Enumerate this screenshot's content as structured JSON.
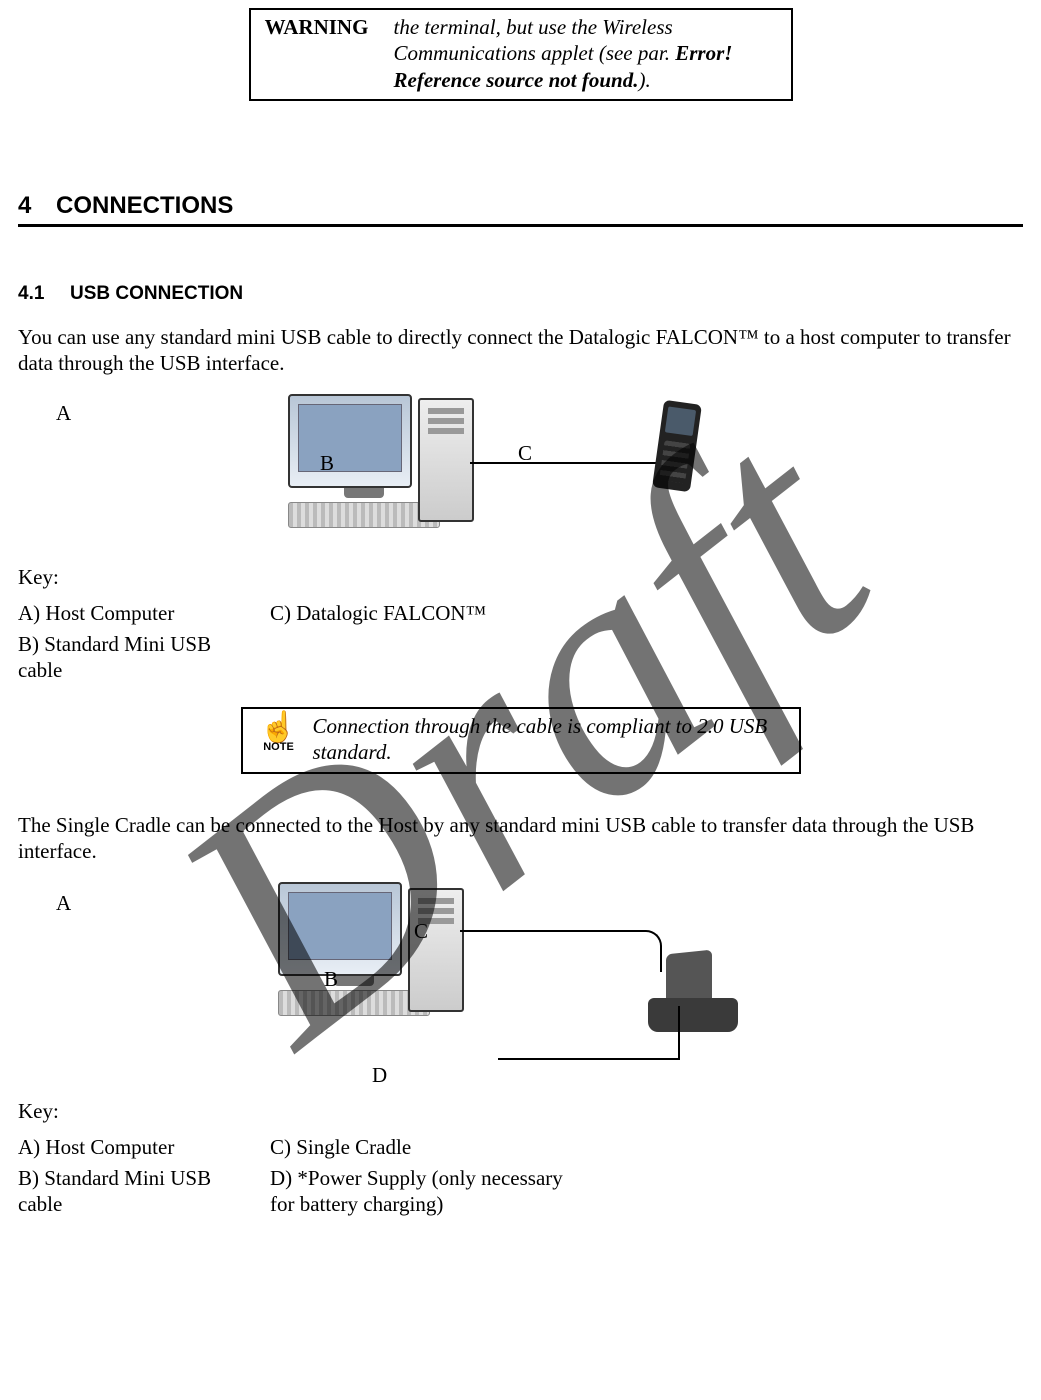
{
  "watermark": "Draft",
  "warning": {
    "label": "WARNING",
    "text_before": "the terminal, but use the Wireless Communications applet (see par. ",
    "error": "Error! Reference source not found.",
    "text_after": ")."
  },
  "section": {
    "num": "4",
    "title": "CONNECTIONS"
  },
  "subsection": {
    "num": "4.1",
    "title": "USB CONNECTION"
  },
  "para1": "You can use any standard mini USB cable to directly connect the Datalogic FALCON™ to a host computer to transfer data through the USB interface.",
  "fig1_labels": {
    "A": "A",
    "B": "B",
    "C": "C"
  },
  "key_label": "Key:",
  "key1": {
    "A": "A)  Host Computer",
    "B": "B)  Standard Mini USB cable",
    "C": "C)  Datalogic FALCON™"
  },
  "note": {
    "caption": "NOTE",
    "text": "Connection through the cable is compliant to 2.0 USB standard."
  },
  "para2": "The Single Cradle can be connected to the Host by any standard mini USB cable to transfer data through the USB interface.",
  "fig2_labels": {
    "A": "A",
    "B": "B",
    "C": "C",
    "D": "D"
  },
  "key2": {
    "A": "A)  Host Computer",
    "B": "B)  Standard Mini USB cable",
    "C": "C)  Single Cradle",
    "D": "D)  *Power Supply (only necessary for battery charging)"
  }
}
